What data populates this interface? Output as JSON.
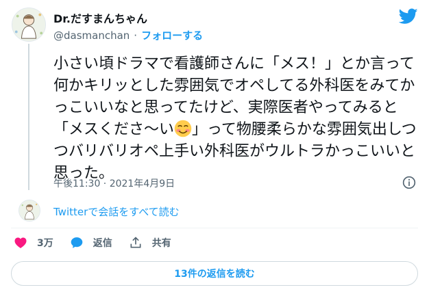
{
  "author": {
    "name": "Dr.だすまんちゃん",
    "handle": "@dasmanchan",
    "separator": "·",
    "follow_label": "フォローする"
  },
  "tweet": {
    "text_before_emoji": "小さい頃ドラマで看護師さんに「メス！」とか言って何かキリッとした雰囲気でオペしてる外科医をみてかっこいいなと思ってたけど、実際医者やってみると「メスくださ〜い",
    "emoji": "smiling-face-with-blush",
    "text_after_emoji": "」って物腰柔らかな雰囲気出しつつバリバリオペ上手い外科医がウルトラかっこいいと思った。",
    "timestamp": "午後11:30 · 2021年4月9日"
  },
  "conversation_link": "Twitterで会話をすべて読む",
  "actions": {
    "like_count": "3万",
    "reply_label": "返信",
    "share_label": "共有"
  },
  "read_replies_label": "13件の返信を読む",
  "colors": {
    "accent": "#1d9bf0",
    "like": "#f91880",
    "text": "#0f1419",
    "muted": "#536471"
  },
  "icons": [
    "twitter-bird-icon",
    "info-icon",
    "heart-icon",
    "reply-bubble-icon",
    "share-icon"
  ]
}
